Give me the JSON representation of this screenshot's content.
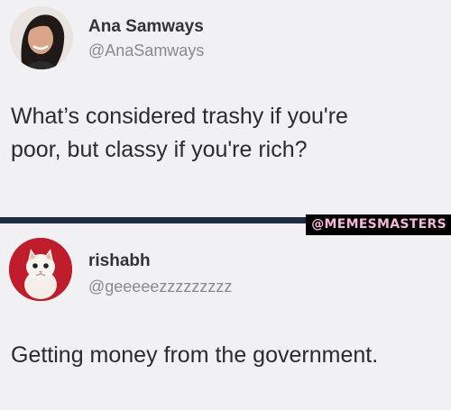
{
  "tweets": [
    {
      "name": "Ana Samways",
      "handle": "@AnaSamways",
      "text": "What’s considered trashy if you're\npoor, but classy if you're rich?"
    },
    {
      "name": "rishabh",
      "handle": "@geeeeezzzzzzzzz",
      "text": "Getting money from the government."
    }
  ],
  "watermark": "@MEMESMASTERS",
  "colors": {
    "background": "#f1f1f3",
    "divider": "#1e2a44",
    "watermark_bg": "#000000",
    "watermark_text": "#f5b8d8",
    "handle": "#8a8a8e"
  }
}
